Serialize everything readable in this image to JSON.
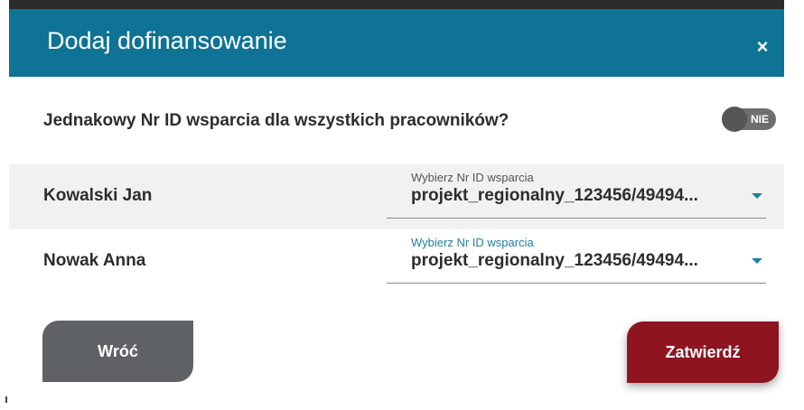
{
  "dialog": {
    "title": "Dodaj dofinansowanie",
    "close_symbol": "×"
  },
  "question": {
    "label": "Jednakowy Nr ID wsparcia dla wszystkich pracowników?",
    "toggle_text": "NIE",
    "toggle_on": false
  },
  "employees": [
    {
      "name": "Kowalski Jan",
      "select_label": "Wybierz Nr ID wsparcia",
      "select_value": "projekt_regionalny_123456/49494..."
    },
    {
      "name": "Nowak Anna",
      "select_label": "Wybierz Nr ID wsparcia",
      "select_value": "projekt_regionalny_123456/49494..."
    }
  ],
  "buttons": {
    "back_label": "Wróć",
    "confirm_label": "Zatwierdź"
  },
  "colors": {
    "header": "#0e7394",
    "accent": "#1f7fa0",
    "back_button": "#5e6265",
    "confirm_button": "#8e1420"
  },
  "icons": {
    "close": "close-icon",
    "dropdown": "chevron-down-icon"
  }
}
